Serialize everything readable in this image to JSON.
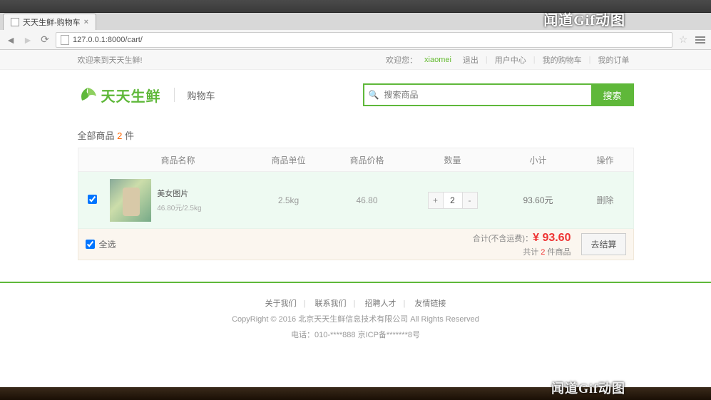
{
  "browser": {
    "tab_title": "天天生鲜-购物车",
    "url": "127.0.0.1:8000/cart/"
  },
  "watermark": "闻道Gif动图",
  "topbar": {
    "welcome": "欢迎来到天天生鲜!",
    "greet": "欢迎您：",
    "username": "xiaomei",
    "logout": "退出",
    "usercenter": "用户中心",
    "mycart": "我的购物车",
    "myorder": "我的订单"
  },
  "header": {
    "brand": "天天生鲜",
    "subtitle": "购物车",
    "search_placeholder": "搜索商品",
    "search_btn": "搜索"
  },
  "cart": {
    "title_prefix": "全部商品 ",
    "title_count": "2",
    "title_suffix": " 件",
    "cols": {
      "name": "商品名称",
      "unit": "商品单位",
      "price": "商品价格",
      "qty": "数量",
      "sub": "小计",
      "op": "操作"
    },
    "items": [
      {
        "name": "美女图片",
        "info": "46.80元/2.5kg",
        "unit": "2.5kg",
        "price": "46.80",
        "qty": "2",
        "subtotal": "93.60元",
        "op": "删除"
      }
    ],
    "footer": {
      "selectall": "全选",
      "total_label": "合计(不含运费)：",
      "currency": "¥ ",
      "total_amount": "93.60",
      "count_prefix": "共计 ",
      "count": "2",
      "count_suffix": " 件商品",
      "checkout": "去结算"
    }
  },
  "footer": {
    "links": {
      "about": "关于我们",
      "contact": "联系我们",
      "recruit": "招聘人才",
      "friend": "友情链接"
    },
    "copy": "CopyRight © 2016 北京天天生鲜信息技术有限公司 All Rights Reserved",
    "tel": "电话：010-****888 京ICP备*******8号"
  }
}
